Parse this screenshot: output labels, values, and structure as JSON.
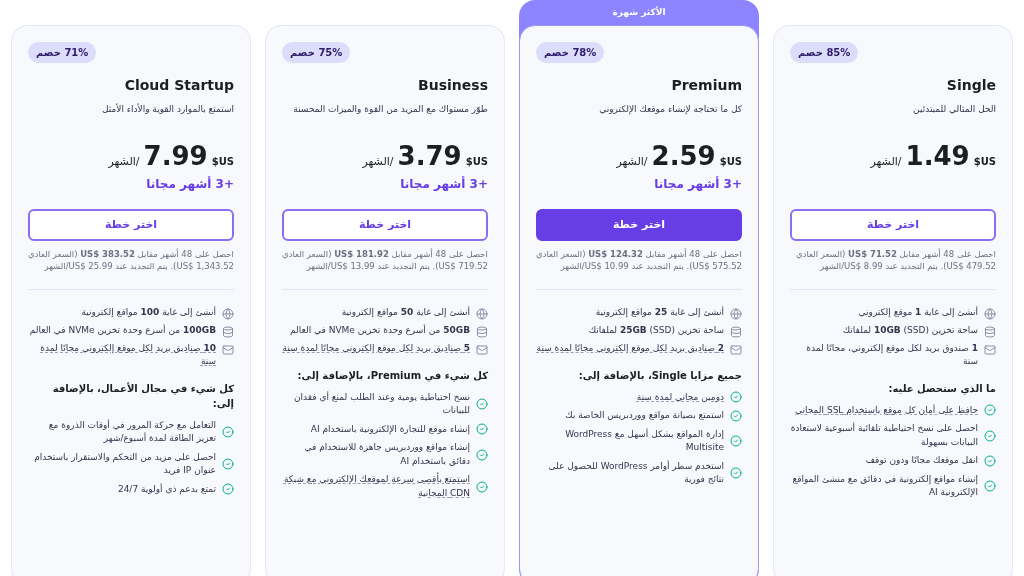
{
  "plans": [
    {
      "name": "Single",
      "popular": false,
      "discount": "85% خصم",
      "description": "الحل المثالي للمبتدئين",
      "currency": "US$",
      "price": "1.49",
      "period": "/الشهر",
      "button": "اختر خطة",
      "note": "احصل على 48 أشهر مقابل **US$ 71.52** (السعر العادي US$ 479.52). يتم التجديد عند US$ 8.99/الشهر",
      "features": [
        {
          "kind": "globe",
          "text": "أنشئ إلى غاية **1** موقع إلكتروني",
          "dotted": false
        },
        {
          "kind": "storage",
          "text": "ساحة تخزين (SSD) **10GB** لملفاتك",
          "dotted": false
        },
        {
          "kind": "mail",
          "text": "**1** صندوق بريد لكل موقع إلكتروني، مجانًا لمدة سنة",
          "dotted": false
        }
      ],
      "extras_title": "ما الذي ستحصل عليه:",
      "extras": [
        {
          "text": "حافظ على أمان كل موقع باستخدام SSL المجاني",
          "dotted": true
        },
        {
          "text": "احصل على نسخ احتياطية تلقائية أسبوعية لاستعادة البيانات بسهولة",
          "dotted": false
        },
        {
          "text": "انقل موقعك مجانًا ودون توقف",
          "dotted": false
        },
        {
          "text": "إنشاء مواقع إلكترونية في دقائق مع منشئ المواقع الإلكترونية AI",
          "dotted": false
        }
      ]
    },
    {
      "name": "Premium",
      "popular": true,
      "popular_label": "الأكثر شهرة",
      "discount": "78% خصم",
      "description": "كل ما تحتاجه لإنشاء موقعك الإلكتروني",
      "currency": "US$",
      "price": "2.59",
      "period": "/الشهر",
      "free_months": "+3 أشهر مجانا",
      "button": "اختر خطة",
      "note": "احصل على 48 أشهر مقابل **US$ 124.32** (السعر العادي US$ 575.52). يتم التجديد عند US$ 10.99/الشهر",
      "features": [
        {
          "kind": "globe",
          "text": "أنشئ إلى غاية **25** مواقع إلكترونية",
          "dotted": false
        },
        {
          "kind": "storage",
          "text": "ساحة تخزين (SSD) **25GB** لملفاتك",
          "dotted": false
        },
        {
          "kind": "mail",
          "text": "**2** صناديق بريد لكل موقع إلكتروني مجانًا لمدة سنة",
          "dotted": true
        }
      ],
      "extras_title": "جميع مزايا Single، بالإضافة إلى:",
      "extras": [
        {
          "text": "دومين مجاني لمدة سنة",
          "dotted": true
        },
        {
          "text": "استمتع بصيانة مواقع ووردبريس الخاصة بك",
          "dotted": false
        },
        {
          "text": "إدارة المواقع بشكل أسهل مع WordPress Multisite",
          "dotted": false
        },
        {
          "text": "استخدم سطر أوامر WordPress للحصول على نتائج فورية",
          "dotted": false
        }
      ]
    },
    {
      "name": "Business",
      "popular": false,
      "discount": "75% خصم",
      "description": "طوّر مستواك مع المزيد من القوة والميزات المحسنة",
      "currency": "US$",
      "price": "3.79",
      "period": "/الشهر",
      "free_months": "+3 أشهر مجانا",
      "button": "اختر خطة",
      "note": "احصل على 48 أشهر مقابل **US$ 181.92** (السعر العادي US$ 719.52). يتم التجديد عند US$ 13.99/الشهر",
      "features": [
        {
          "kind": "globe",
          "text": "أنشئ إلى غاية **50** مواقع إلكترونية",
          "dotted": false
        },
        {
          "kind": "storage",
          "text": "**50GB** من أسرع وحدة تخزين NVMe في العالم",
          "dotted": false
        },
        {
          "kind": "mail",
          "text": "**5** صناديق بريد لكل موقع إلكتروني مجانًا لمدة سنة",
          "dotted": true
        }
      ],
      "extras_title": "كل شيء في Premium، بالإضافة إلى:",
      "extras": [
        {
          "text": "نسخ احتياطية يومية وعند الطلب لمنع أي فقدان للبيانات",
          "dotted": false
        },
        {
          "text": "إنشاء موقع للتجارة الإلكترونية باستخدام AI",
          "dotted": false
        },
        {
          "text": "إنشاء مواقع ووردبريس جاهزة للاستخدام في دقائق باستخدام AI",
          "dotted": false
        },
        {
          "text": "استمتع بأقصى سرعة لموقعك الإلكتروني مع شبكة CDN المجانية",
          "dotted": true
        }
      ]
    },
    {
      "name": "Cloud Startup",
      "popular": false,
      "discount": "71% خصم",
      "description": "استمتع بالموارد القوية والأداء الأمثل",
      "currency": "US$",
      "price": "7.99",
      "period": "/الشهر",
      "free_months": "+3 أشهر مجانا",
      "button": "اختر خطة",
      "note": "احصل على 48 أشهر مقابل **US$ 383.52** (السعر العادي US$ 1,343.52). يتم التجديد عند US$ 25.99/الشهر",
      "features": [
        {
          "kind": "globe",
          "text": "أنشئ إلى غاية **100** مواقع إلكترونية",
          "dotted": false
        },
        {
          "kind": "storage",
          "text": "**100GB** من أسرع وحدة تخزين NVMe في العالم",
          "dotted": false
        },
        {
          "kind": "mail",
          "text": "**10** صناديق بريد لكل موقع إلكتروني مجانًا لمدة سنة",
          "dotted": true
        }
      ],
      "extras_title": "كل شيء في مجال الأعمال، بالإضافة إلى:",
      "extras": [
        {
          "text": "التعامل مع حركة المرور في أوقات الذروة مع تعزيز الطاقة لمدة أسبوع/شهر",
          "dotted": false
        },
        {
          "text": "احصل على مزيد من التحكم والاستقرار باستخدام عنوان IP فريد",
          "dotted": false
        },
        {
          "text": "تمتع بدعم ذي أولوية 24/7",
          "dotted": false
        }
      ]
    }
  ]
}
